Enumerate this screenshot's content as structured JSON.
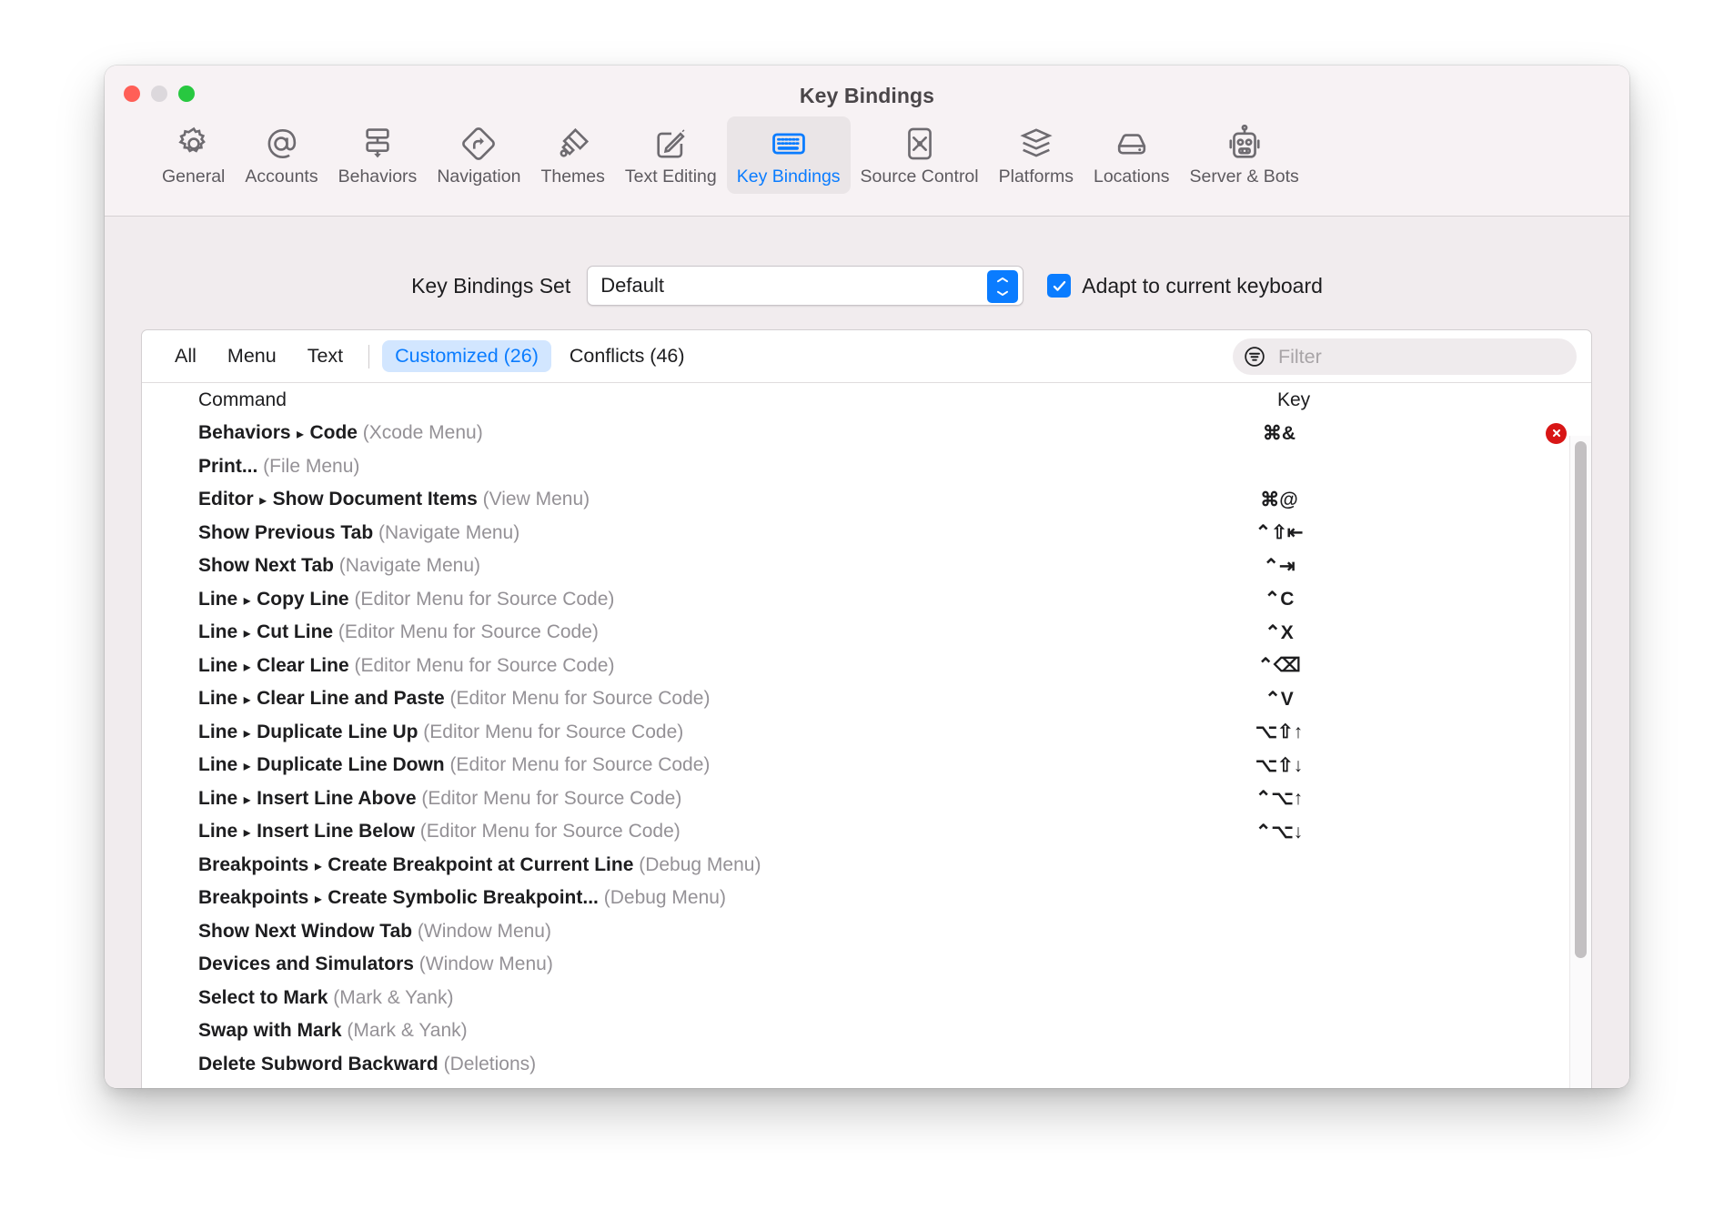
{
  "window": {
    "title": "Key Bindings",
    "traffic_lights": [
      "close",
      "minimize",
      "zoom"
    ],
    "accent_color": "#0a7cff",
    "error_color": "#d81616"
  },
  "toolbar": {
    "tabs": [
      {
        "label": "General",
        "icon": "gear-icon",
        "selected": false
      },
      {
        "label": "Accounts",
        "icon": "at-sign-icon",
        "selected": false
      },
      {
        "label": "Behaviors",
        "icon": "behaviors-icon",
        "selected": false
      },
      {
        "label": "Navigation",
        "icon": "road-sign-arrow-icon",
        "selected": false
      },
      {
        "label": "Themes",
        "icon": "paintbrush-icon",
        "selected": false
      },
      {
        "label": "Text Editing",
        "icon": "pencil-square-icon",
        "selected": false
      },
      {
        "label": "Key Bindings",
        "icon": "keyboard-icon",
        "selected": true
      },
      {
        "label": "Source Control",
        "icon": "merge-box-icon",
        "selected": false
      },
      {
        "label": "Platforms",
        "icon": "layers-icon",
        "selected": false
      },
      {
        "label": "Locations",
        "icon": "drive-icon",
        "selected": false
      },
      {
        "label": "Server & Bots",
        "icon": "robot-icon",
        "selected": false
      }
    ]
  },
  "settings": {
    "set_label": "Key Bindings Set",
    "set_value": "Default",
    "set_options": [
      "Default"
    ],
    "adapt_label": "Adapt to current keyboard",
    "adapt_checked": true
  },
  "filterbar": {
    "segments": [
      {
        "label": "All",
        "selected": false
      },
      {
        "label": "Menu",
        "selected": false
      },
      {
        "label": "Text",
        "selected": false
      },
      {
        "label": "Customized (26)",
        "selected": true
      },
      {
        "label": "Conflicts (46)",
        "selected": false
      }
    ],
    "filter_icon": "filter-lines-circle-icon",
    "filter_placeholder": "Filter",
    "filter_value": ""
  },
  "table": {
    "columns": {
      "command": "Command",
      "key": "Key"
    },
    "rows": [
      {
        "command": "Behaviors",
        "sub": "Code",
        "scope": "(Xcode Menu)",
        "key": "⌘&",
        "error": true
      },
      {
        "command": "Print...",
        "sub": "",
        "scope": "(File Menu)",
        "key": "",
        "error": false
      },
      {
        "command": "Editor",
        "sub": "Show Document Items",
        "scope": "(View Menu)",
        "key": "⌘@",
        "error": false
      },
      {
        "command": "Show Previous Tab",
        "sub": "",
        "scope": "(Navigate Menu)",
        "key": "⌃⇧⇤",
        "error": false
      },
      {
        "command": "Show Next Tab",
        "sub": "",
        "scope": "(Navigate Menu)",
        "key": "⌃⇥",
        "error": false
      },
      {
        "command": "Line",
        "sub": "Copy Line",
        "scope": "(Editor Menu for Source Code)",
        "key": "⌃C",
        "error": false
      },
      {
        "command": "Line",
        "sub": "Cut Line",
        "scope": "(Editor Menu for Source Code)",
        "key": "⌃X",
        "error": false
      },
      {
        "command": "Line",
        "sub": "Clear Line",
        "scope": "(Editor Menu for Source Code)",
        "key": "⌃⌫",
        "error": false
      },
      {
        "command": "Line",
        "sub": "Clear Line and Paste",
        "scope": "(Editor Menu for Source Code)",
        "key": "⌃V",
        "error": false
      },
      {
        "command": "Line",
        "sub": "Duplicate Line Up",
        "scope": "(Editor Menu for Source Code)",
        "key": "⌥⇧↑",
        "error": false
      },
      {
        "command": "Line",
        "sub": "Duplicate Line Down",
        "scope": "(Editor Menu for Source Code)",
        "key": "⌥⇧↓",
        "error": false
      },
      {
        "command": "Line",
        "sub": "Insert Line Above",
        "scope": "(Editor Menu for Source Code)",
        "key": "⌃⌥↑",
        "error": false
      },
      {
        "command": "Line",
        "sub": "Insert Line Below",
        "scope": "(Editor Menu for Source Code)",
        "key": "⌃⌥↓",
        "error": false
      },
      {
        "command": "Breakpoints",
        "sub": "Create Breakpoint at Current Line",
        "scope": "(Debug Menu)",
        "key": "",
        "error": false
      },
      {
        "command": "Breakpoints",
        "sub": "Create Symbolic Breakpoint...",
        "scope": "(Debug Menu)",
        "key": "",
        "error": false
      },
      {
        "command": "Show Next Window Tab",
        "sub": "",
        "scope": "(Window Menu)",
        "key": "",
        "error": false
      },
      {
        "command": "Devices and Simulators",
        "sub": "",
        "scope": "(Window Menu)",
        "key": "",
        "error": false
      },
      {
        "command": "Select to Mark",
        "sub": "",
        "scope": "(Mark & Yank)",
        "key": "",
        "error": false
      },
      {
        "command": "Swap with Mark",
        "sub": "",
        "scope": "(Mark & Yank)",
        "key": "",
        "error": false
      },
      {
        "command": "Delete Subword Backward",
        "sub": "",
        "scope": "(Deletions)",
        "key": "",
        "error": false
      }
    ]
  }
}
